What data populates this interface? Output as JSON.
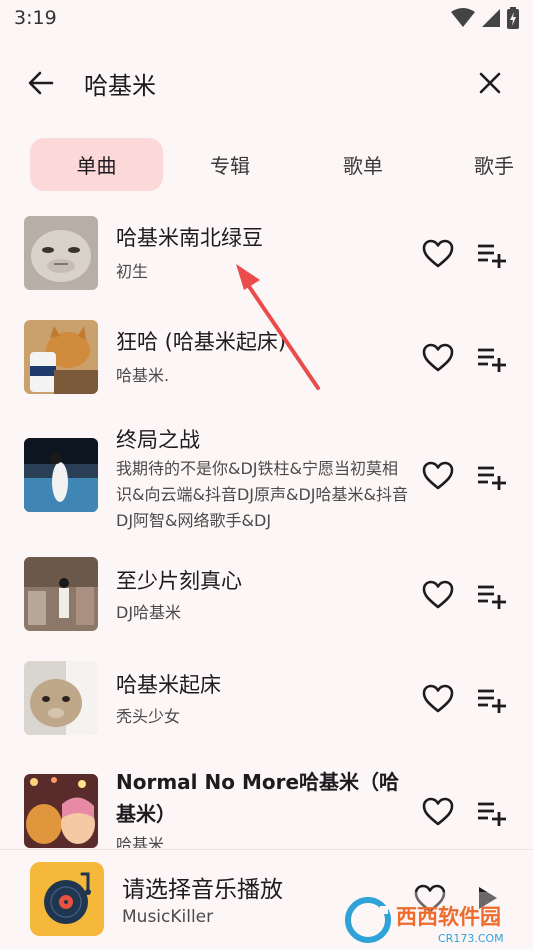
{
  "status": {
    "time": "3:19"
  },
  "search": {
    "query": "哈基米"
  },
  "tabs": [
    {
      "label": "单曲"
    },
    {
      "label": "专辑"
    },
    {
      "label": "歌单"
    },
    {
      "label": "歌手"
    }
  ],
  "songs": [
    {
      "title": "哈基米南北绿豆",
      "artist": "初生"
    },
    {
      "title": "狂哈 (哈基米起床)",
      "artist": "哈基米."
    },
    {
      "title": "终局之战",
      "artist": "我期待的不是你&DJ铁柱&宁愿当初莫相识&向云端&抖音DJ原声&DJ哈基米&抖音DJ阿智&网络歌手&DJ"
    },
    {
      "title": "至少片刻真心",
      "artist": "DJ哈基米"
    },
    {
      "title": "哈基米起床",
      "artist": "秃头少女"
    },
    {
      "title": "Normal No More哈基米（哈基米）",
      "artist": "哈基米"
    }
  ],
  "player": {
    "title": "请选择音乐播放",
    "artist": "MusicKiller"
  },
  "watermark": {
    "brand": "西西软件园",
    "site": "CR173.COM"
  },
  "colors": {
    "accent_tab": "#fcd9d8",
    "background": "#fdf6f6",
    "arrow": "#ea4b4b",
    "player_cover": "#f6b83a"
  }
}
